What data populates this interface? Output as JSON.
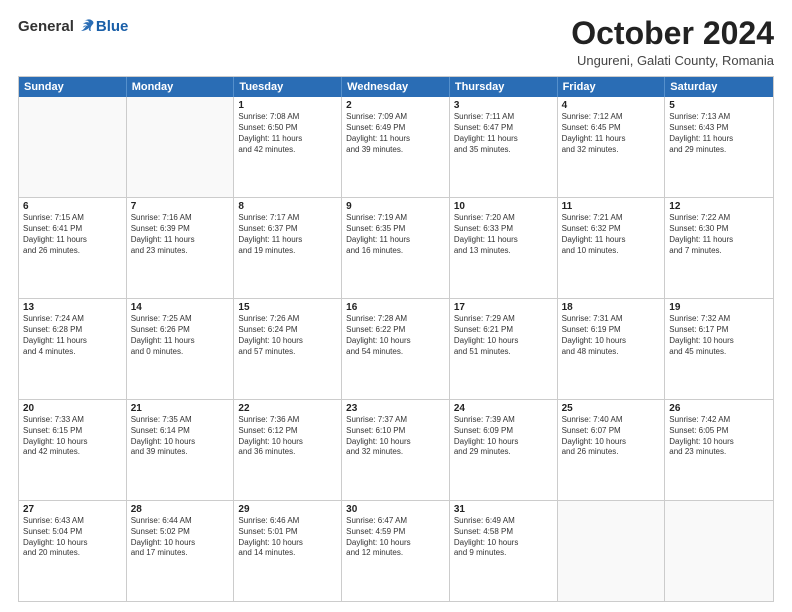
{
  "logo": {
    "general": "General",
    "blue": "Blue"
  },
  "header": {
    "month": "October 2024",
    "location": "Ungureni, Galati County, Romania"
  },
  "days": [
    "Sunday",
    "Monday",
    "Tuesday",
    "Wednesday",
    "Thursday",
    "Friday",
    "Saturday"
  ],
  "rows": [
    [
      {
        "day": "",
        "lines": []
      },
      {
        "day": "",
        "lines": []
      },
      {
        "day": "1",
        "lines": [
          "Sunrise: 7:08 AM",
          "Sunset: 6:50 PM",
          "Daylight: 11 hours",
          "and 42 minutes."
        ]
      },
      {
        "day": "2",
        "lines": [
          "Sunrise: 7:09 AM",
          "Sunset: 6:49 PM",
          "Daylight: 11 hours",
          "and 39 minutes."
        ]
      },
      {
        "day": "3",
        "lines": [
          "Sunrise: 7:11 AM",
          "Sunset: 6:47 PM",
          "Daylight: 11 hours",
          "and 35 minutes."
        ]
      },
      {
        "day": "4",
        "lines": [
          "Sunrise: 7:12 AM",
          "Sunset: 6:45 PM",
          "Daylight: 11 hours",
          "and 32 minutes."
        ]
      },
      {
        "day": "5",
        "lines": [
          "Sunrise: 7:13 AM",
          "Sunset: 6:43 PM",
          "Daylight: 11 hours",
          "and 29 minutes."
        ]
      }
    ],
    [
      {
        "day": "6",
        "lines": [
          "Sunrise: 7:15 AM",
          "Sunset: 6:41 PM",
          "Daylight: 11 hours",
          "and 26 minutes."
        ]
      },
      {
        "day": "7",
        "lines": [
          "Sunrise: 7:16 AM",
          "Sunset: 6:39 PM",
          "Daylight: 11 hours",
          "and 23 minutes."
        ]
      },
      {
        "day": "8",
        "lines": [
          "Sunrise: 7:17 AM",
          "Sunset: 6:37 PM",
          "Daylight: 11 hours",
          "and 19 minutes."
        ]
      },
      {
        "day": "9",
        "lines": [
          "Sunrise: 7:19 AM",
          "Sunset: 6:35 PM",
          "Daylight: 11 hours",
          "and 16 minutes."
        ]
      },
      {
        "day": "10",
        "lines": [
          "Sunrise: 7:20 AM",
          "Sunset: 6:33 PM",
          "Daylight: 11 hours",
          "and 13 minutes."
        ]
      },
      {
        "day": "11",
        "lines": [
          "Sunrise: 7:21 AM",
          "Sunset: 6:32 PM",
          "Daylight: 11 hours",
          "and 10 minutes."
        ]
      },
      {
        "day": "12",
        "lines": [
          "Sunrise: 7:22 AM",
          "Sunset: 6:30 PM",
          "Daylight: 11 hours",
          "and 7 minutes."
        ]
      }
    ],
    [
      {
        "day": "13",
        "lines": [
          "Sunrise: 7:24 AM",
          "Sunset: 6:28 PM",
          "Daylight: 11 hours",
          "and 4 minutes."
        ]
      },
      {
        "day": "14",
        "lines": [
          "Sunrise: 7:25 AM",
          "Sunset: 6:26 PM",
          "Daylight: 11 hours",
          "and 0 minutes."
        ]
      },
      {
        "day": "15",
        "lines": [
          "Sunrise: 7:26 AM",
          "Sunset: 6:24 PM",
          "Daylight: 10 hours",
          "and 57 minutes."
        ]
      },
      {
        "day": "16",
        "lines": [
          "Sunrise: 7:28 AM",
          "Sunset: 6:22 PM",
          "Daylight: 10 hours",
          "and 54 minutes."
        ]
      },
      {
        "day": "17",
        "lines": [
          "Sunrise: 7:29 AM",
          "Sunset: 6:21 PM",
          "Daylight: 10 hours",
          "and 51 minutes."
        ]
      },
      {
        "day": "18",
        "lines": [
          "Sunrise: 7:31 AM",
          "Sunset: 6:19 PM",
          "Daylight: 10 hours",
          "and 48 minutes."
        ]
      },
      {
        "day": "19",
        "lines": [
          "Sunrise: 7:32 AM",
          "Sunset: 6:17 PM",
          "Daylight: 10 hours",
          "and 45 minutes."
        ]
      }
    ],
    [
      {
        "day": "20",
        "lines": [
          "Sunrise: 7:33 AM",
          "Sunset: 6:15 PM",
          "Daylight: 10 hours",
          "and 42 minutes."
        ]
      },
      {
        "day": "21",
        "lines": [
          "Sunrise: 7:35 AM",
          "Sunset: 6:14 PM",
          "Daylight: 10 hours",
          "and 39 minutes."
        ]
      },
      {
        "day": "22",
        "lines": [
          "Sunrise: 7:36 AM",
          "Sunset: 6:12 PM",
          "Daylight: 10 hours",
          "and 36 minutes."
        ]
      },
      {
        "day": "23",
        "lines": [
          "Sunrise: 7:37 AM",
          "Sunset: 6:10 PM",
          "Daylight: 10 hours",
          "and 32 minutes."
        ]
      },
      {
        "day": "24",
        "lines": [
          "Sunrise: 7:39 AM",
          "Sunset: 6:09 PM",
          "Daylight: 10 hours",
          "and 29 minutes."
        ]
      },
      {
        "day": "25",
        "lines": [
          "Sunrise: 7:40 AM",
          "Sunset: 6:07 PM",
          "Daylight: 10 hours",
          "and 26 minutes."
        ]
      },
      {
        "day": "26",
        "lines": [
          "Sunrise: 7:42 AM",
          "Sunset: 6:05 PM",
          "Daylight: 10 hours",
          "and 23 minutes."
        ]
      }
    ],
    [
      {
        "day": "27",
        "lines": [
          "Sunrise: 6:43 AM",
          "Sunset: 5:04 PM",
          "Daylight: 10 hours",
          "and 20 minutes."
        ]
      },
      {
        "day": "28",
        "lines": [
          "Sunrise: 6:44 AM",
          "Sunset: 5:02 PM",
          "Daylight: 10 hours",
          "and 17 minutes."
        ]
      },
      {
        "day": "29",
        "lines": [
          "Sunrise: 6:46 AM",
          "Sunset: 5:01 PM",
          "Daylight: 10 hours",
          "and 14 minutes."
        ]
      },
      {
        "day": "30",
        "lines": [
          "Sunrise: 6:47 AM",
          "Sunset: 4:59 PM",
          "Daylight: 10 hours",
          "and 12 minutes."
        ]
      },
      {
        "day": "31",
        "lines": [
          "Sunrise: 6:49 AM",
          "Sunset: 4:58 PM",
          "Daylight: 10 hours",
          "and 9 minutes."
        ]
      },
      {
        "day": "",
        "lines": []
      },
      {
        "day": "",
        "lines": []
      }
    ]
  ]
}
